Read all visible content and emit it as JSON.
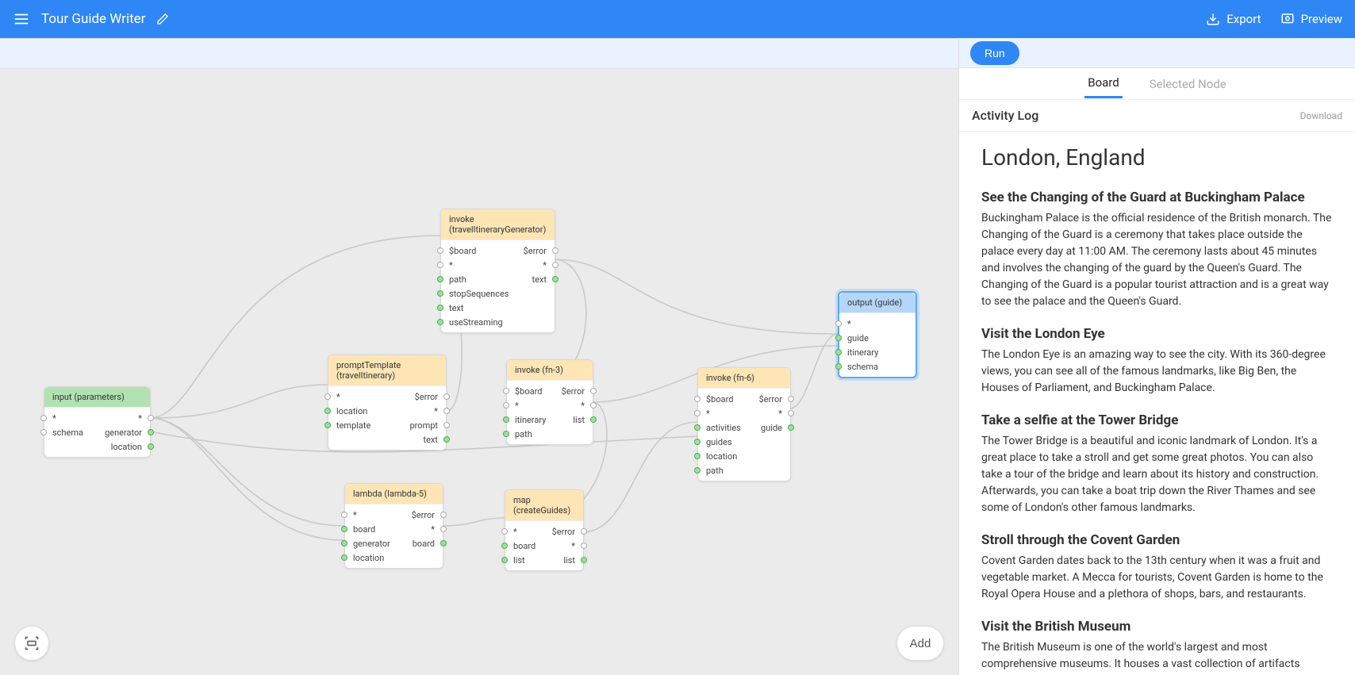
{
  "header": {
    "title": "Tour Guide Writer",
    "export": "Export",
    "preview": "Preview"
  },
  "run_button": "Run",
  "add_button": "Add",
  "tabs": {
    "board": "Board",
    "selected": "Selected Node"
  },
  "activity": {
    "title": "Activity Log",
    "download": "Download"
  },
  "guide": {
    "title": "London, England",
    "sections": [
      {
        "heading": "See the Changing of the Guard at Buckingham Palace",
        "body": "Buckingham Palace is the official residence of the British monarch. The Changing of the Guard is a ceremony that takes place outside the palace every day at 11:00 AM. The ceremony lasts about 45 minutes and involves the changing of the guard by the Queen's Guard. The Changing of the Guard is a popular tourist attraction and is a great way to see the palace and the Queen's Guard."
      },
      {
        "heading": "Visit the London Eye",
        "body": "The London Eye is an amazing way to see the city. With its 360-degree views, you can see all of the famous landmarks, like Big Ben, the Houses of Parliament, and Buckingham Palace."
      },
      {
        "heading": "Take a selfie at the Tower Bridge",
        "body": "The Tower Bridge is a beautiful and iconic landmark of London. It's a great place to take a stroll and get some great photos. You can also take a tour of the bridge and learn about its history and construction. Afterwards, you can take a boat trip down the River Thames and see some of London's other famous landmarks."
      },
      {
        "heading": "Stroll through the Covent Garden",
        "body": "Covent Garden dates back to the 13th century when it was a fruit and vegetable market. A Mecca for tourists, Covent Garden is home to the Royal Opera House and a plethora of shops, bars, and restaurants."
      },
      {
        "heading": "Visit the British Museum",
        "body": "The British Museum is one of the world's largest and most comprehensive museums. It houses a vast collection of artifacts"
      }
    ]
  },
  "nodes": {
    "input": {
      "title": "input (parameters)",
      "rows": [
        {
          "l": "*",
          "r": "*"
        },
        {
          "l": "schema",
          "r": "generator"
        },
        {
          "l": "",
          "r": "location"
        }
      ]
    },
    "prompt": {
      "title": "promptTemplate (travelItinerary)",
      "rows": [
        {
          "l": "*",
          "r": "$error"
        },
        {
          "l": "location",
          "r": "*"
        },
        {
          "l": "template",
          "r": "prompt"
        },
        {
          "l": "",
          "r": "text"
        }
      ]
    },
    "invoke1": {
      "title": "invoke (travelItineraryGenerator)",
      "rows": [
        {
          "l": "$board",
          "r": "$error"
        },
        {
          "l": "*",
          "r": "*"
        },
        {
          "l": "path",
          "r": "text"
        },
        {
          "l": "stopSequences",
          "r": ""
        },
        {
          "l": "text",
          "r": ""
        },
        {
          "l": "useStreaming",
          "r": ""
        }
      ]
    },
    "invoke2": {
      "title": "invoke (fn-3)",
      "rows": [
        {
          "l": "$board",
          "r": "$error"
        },
        {
          "l": "*",
          "r": "*"
        },
        {
          "l": "itinerary",
          "r": "list"
        },
        {
          "l": "path",
          "r": ""
        }
      ]
    },
    "lambda": {
      "title": "lambda (lambda-5)",
      "rows": [
        {
          "l": "*",
          "r": "$error"
        },
        {
          "l": "board",
          "r": "*"
        },
        {
          "l": "generator",
          "r": "board"
        },
        {
          "l": "location",
          "r": ""
        }
      ]
    },
    "map": {
      "title": "map (createGuides)",
      "rows": [
        {
          "l": "*",
          "r": "$error"
        },
        {
          "l": "board",
          "r": "*"
        },
        {
          "l": "list",
          "r": "list"
        }
      ]
    },
    "invoke3": {
      "title": "invoke (fn-6)",
      "rows": [
        {
          "l": "$board",
          "r": "$error"
        },
        {
          "l": "*",
          "r": "*"
        },
        {
          "l": "activities",
          "r": "guide"
        },
        {
          "l": "guides",
          "r": ""
        },
        {
          "l": "location",
          "r": ""
        },
        {
          "l": "path",
          "r": ""
        }
      ]
    },
    "output": {
      "title": "output (guide)",
      "rows": [
        {
          "l": "*",
          "r": ""
        },
        {
          "l": "guide",
          "r": ""
        },
        {
          "l": "itinerary",
          "r": ""
        },
        {
          "l": "schema",
          "r": ""
        }
      ]
    }
  }
}
